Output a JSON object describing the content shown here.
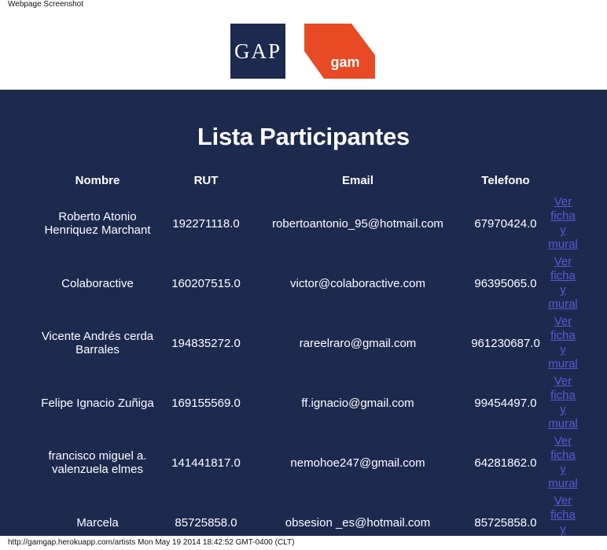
{
  "caption": "Webpage Screenshot",
  "logos": {
    "gap": "GAP",
    "gam": "gam"
  },
  "title": "Lista Participantes",
  "headers": [
    "Nombre",
    "RUT",
    "Email",
    "Telefono"
  ],
  "link_label": "Ver ficha y mural",
  "rows": [
    {
      "nombre": "Roberto Atonio Henriquez Marchant",
      "rut": "192271118.0",
      "email": "robertoantonio_95@hotmail.com",
      "telefono": "67970424.0"
    },
    {
      "nombre": "Colaboractive",
      "rut": "160207515.0",
      "email": "victor@colaboractive.com",
      "telefono": "96395065.0"
    },
    {
      "nombre": "Vicente Andrés cerda Barrales",
      "rut": "194835272.0",
      "email": "rareelraro@gmail.com",
      "telefono": "961230687.0"
    },
    {
      "nombre": "Felipe Ignacio Zuñiga",
      "rut": "169155569.0",
      "email": "ff.ignacio@gmail.com",
      "telefono": "99454497.0"
    },
    {
      "nombre": "francisco miguel a. valenzuela elmes",
      "rut": "141441817.0",
      "email": "nemohoe247@gmail.com",
      "telefono": "64281862.0"
    },
    {
      "nombre": "Marcela",
      "rut": "85725858.0",
      "email": "obsesion _es@hotmail.com",
      "telefono": "85725858.0"
    }
  ],
  "footer": "http://gamgap.herokuapp.com/artists Mon May 19 2014 18:42:52 GMT-0400 (CLT)",
  "colors": {
    "panel": "#1c2a4e",
    "gap_bg": "#1b2a4e",
    "gam_bg": "#e84a24",
    "link": "#5a5ad8"
  }
}
